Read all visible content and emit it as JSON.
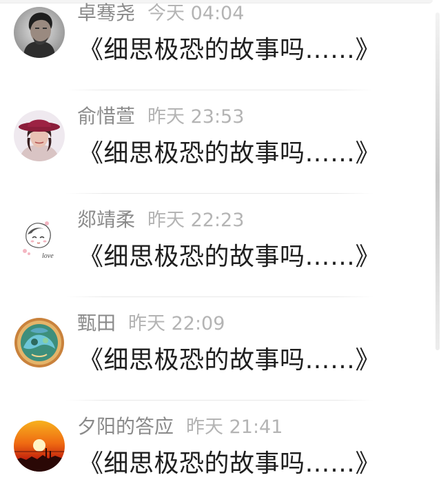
{
  "comments": [
    {
      "user": "卓骞尧",
      "time": "今天 04:04",
      "text": "《细思极恐的故事吗……》",
      "avatar": "man-portrait-avatar"
    },
    {
      "user": "俞惜萱",
      "time": "昨天 23:53",
      "text": "《细思极恐的故事吗……》",
      "avatar": "woman-hat-avatar"
    },
    {
      "user": "郯靖柔",
      "time": "昨天 22:23",
      "text": "《细思极恐的故事吗……》",
      "avatar": "cartoon-girl-love-avatar"
    },
    {
      "user": "甄田",
      "time": "昨天 22:09",
      "text": "《细思极恐的故事吗……》",
      "avatar": "ornate-circle-avatar"
    },
    {
      "user": "夕阳的答应",
      "time": "昨天 21:41",
      "text": "《细思极恐的故事吗……》",
      "avatar": "sunset-avatar"
    }
  ],
  "avatar_word": "love",
  "colors": {
    "name": "#8a8a8a",
    "time": "#b4b4b4",
    "message": "#1f1f1f",
    "divider": "#e8e8e8"
  }
}
